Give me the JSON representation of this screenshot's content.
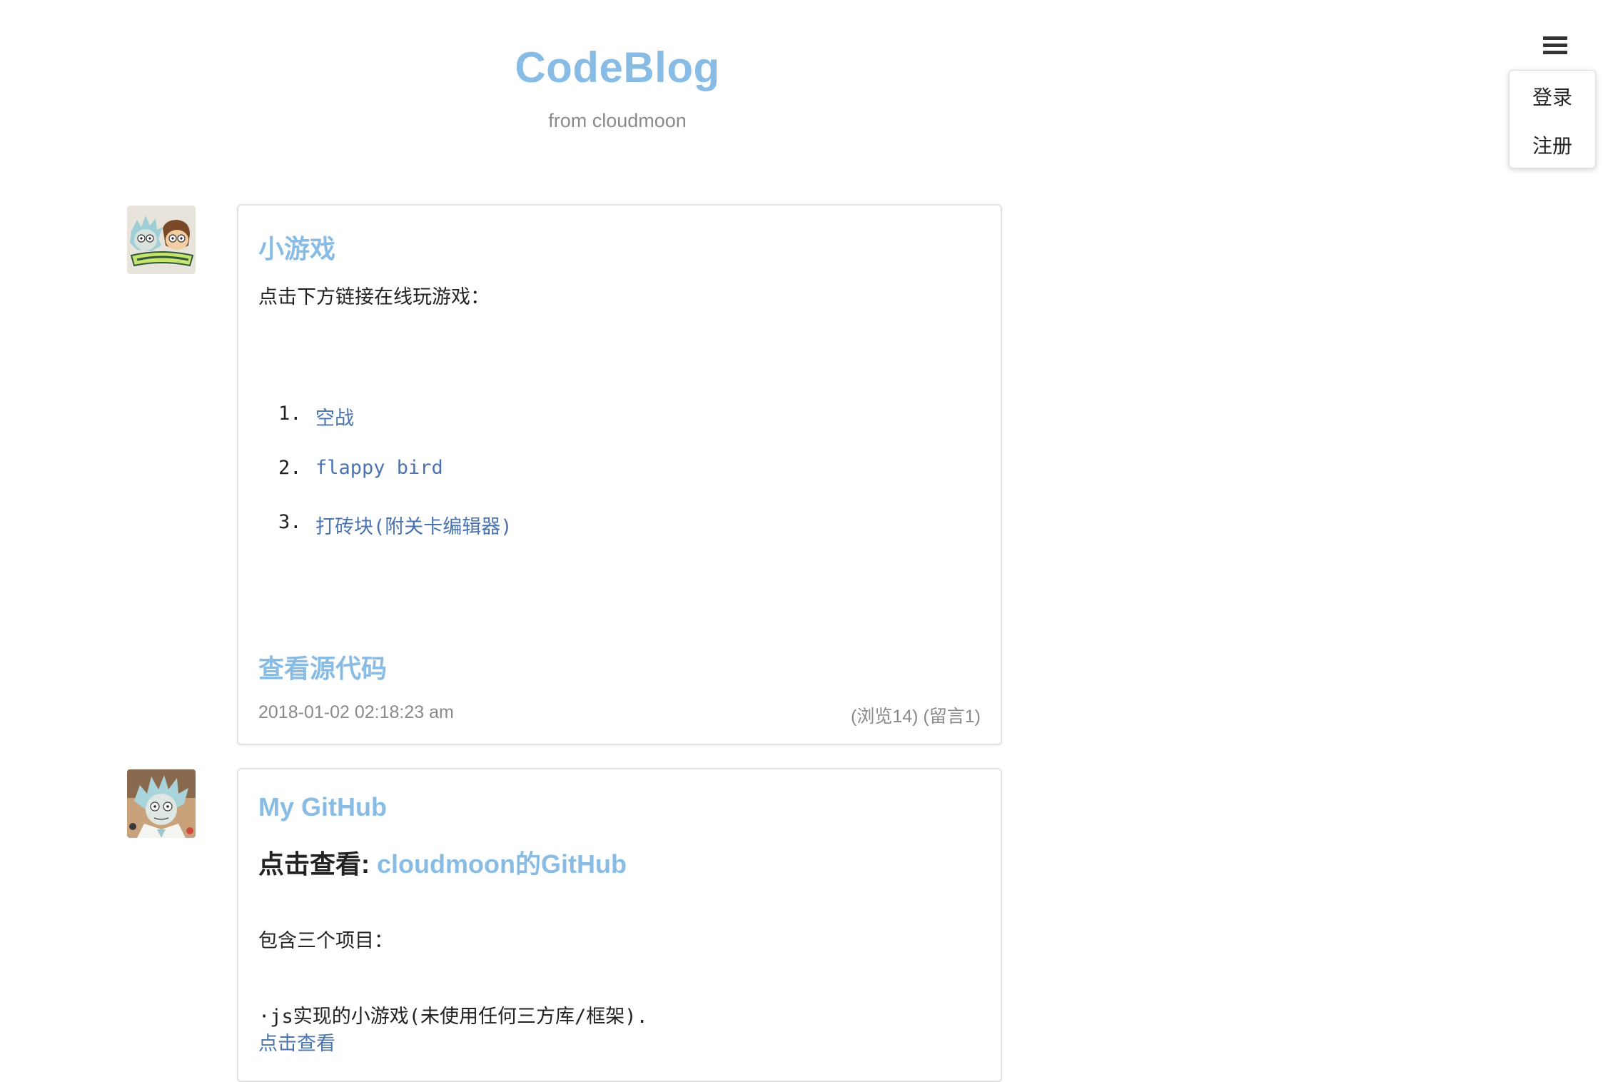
{
  "header": {
    "title": "CodeBlog",
    "subtitle": "from cloudmoon"
  },
  "menu": {
    "icon": "hamburger-menu-icon",
    "items": [
      {
        "label": "登录"
      },
      {
        "label": "注册"
      }
    ]
  },
  "posts": [
    {
      "avatar": "rick-and-morty-avatar",
      "title": "小游戏",
      "intro": "点击下方链接在线玩游戏：",
      "links": [
        {
          "num": "1.",
          "label": "空战"
        },
        {
          "num": "2.",
          "label": "flappy bird"
        },
        {
          "num": "3.",
          "label": "打砖块(附关卡编辑器)"
        }
      ],
      "source_link": "查看源代码",
      "date": "2018-01-02 02:18:23 am",
      "stats": "(浏览14) (留言1)"
    },
    {
      "avatar": "rick-avatar",
      "title": "My GitHub",
      "subheading_prefix": "点击查看: ",
      "subheading_link": "cloudmoon的GitHub",
      "intro": "包含三个项目：",
      "bullet": "·js实现的小游戏(未使用任何三方库/框架).",
      "bullet_link": "点击查看"
    }
  ],
  "colors": {
    "accent": "#88bce4",
    "link": "#4a74b0",
    "muted": "#8a8a8a",
    "text": "#222222"
  }
}
